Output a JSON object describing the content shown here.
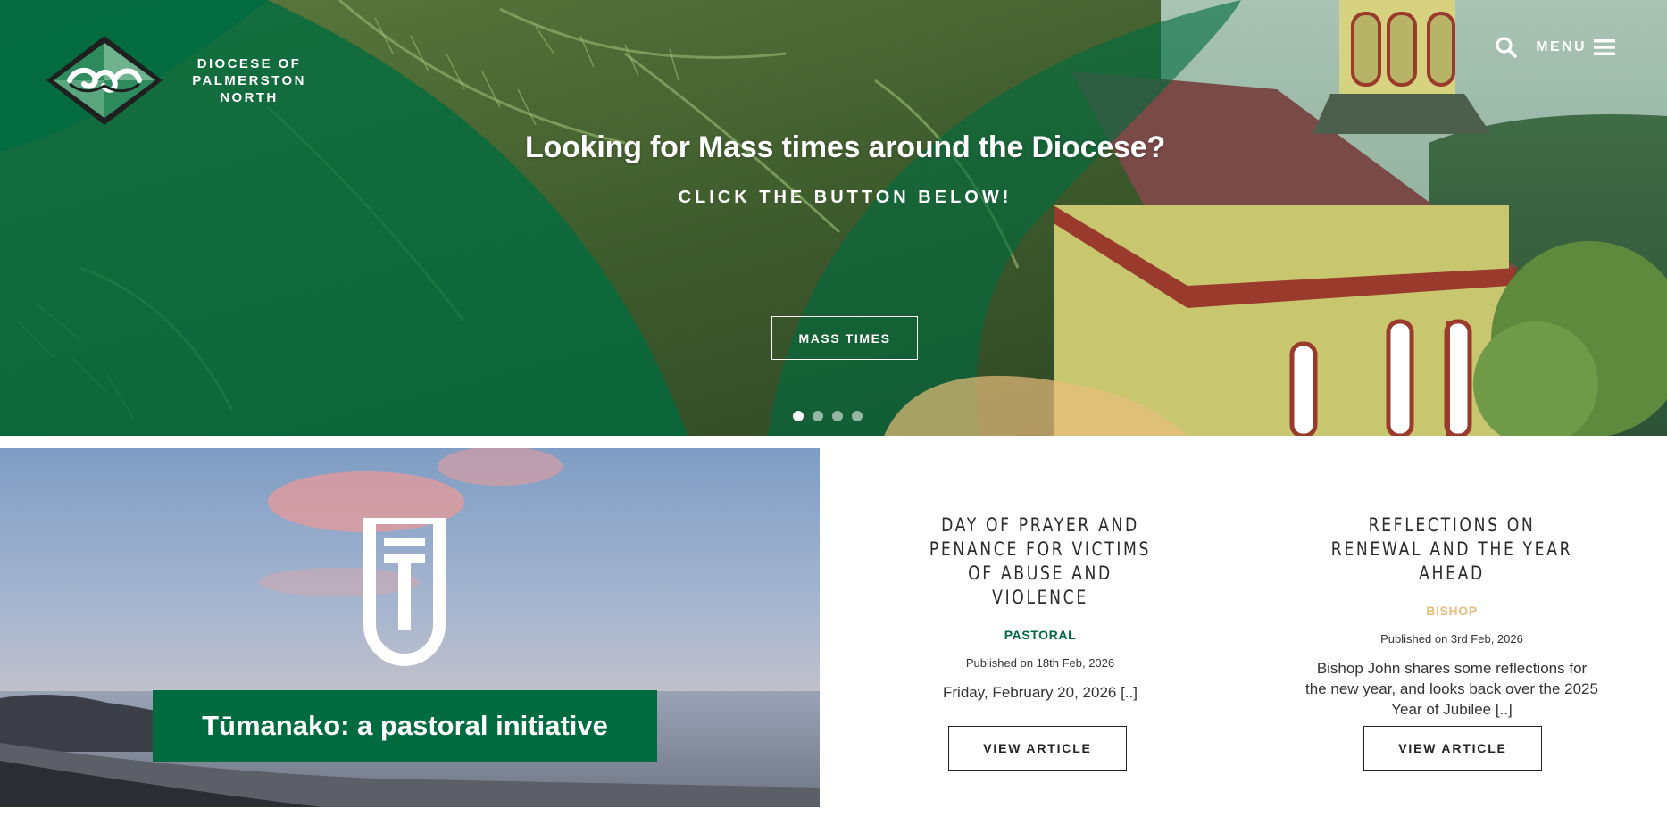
{
  "site": {
    "name_lines": [
      "DIOCESE OF",
      "PALMERSTON",
      "NORTH"
    ],
    "brand_color": "#006b3f",
    "accent_color": "#e8bd7c"
  },
  "header": {
    "menu_label": "MENU",
    "search_icon": "search-icon",
    "menu_icon": "hamburger-icon"
  },
  "hero": {
    "title": "Looking for Mass times around the Diocese?",
    "subtitle": "CLICK THE BUTTON BELOW!",
    "button_label": "MASS TIMES",
    "slides_count": 4,
    "active_slide": 1
  },
  "feature": {
    "banner_text": "Tūmanako: a pastoral initiative"
  },
  "articles": [
    {
      "title": "DAY OF PRAYER AND PENANCE FOR VICTIMS OF ABUSE AND VIOLENCE",
      "category": "PASTORAL",
      "published": "Published on 18th Feb, 2026",
      "excerpt": "Friday, February 20, 2026 [..]",
      "button_label": "VIEW ARTICLE"
    },
    {
      "title": "REFLECTIONS ON RENEWAL AND THE YEAR AHEAD",
      "category": "BISHOP",
      "published": "Published on 3rd Feb, 2026",
      "excerpt": "Bishop John shares some reflections for the new year, and looks back over the 2025 Year of Jubilee [..]",
      "button_label": "VIEW ARTICLE"
    }
  ]
}
